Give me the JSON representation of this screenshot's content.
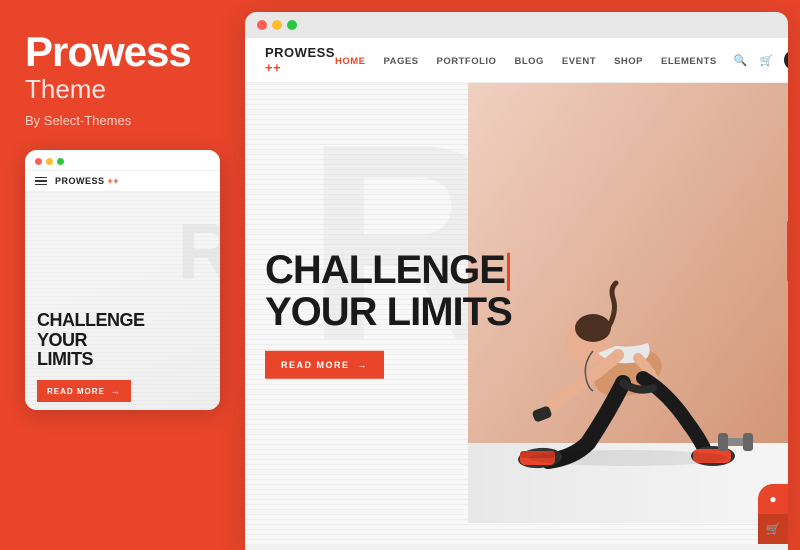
{
  "leftPanel": {
    "title": "Prowess",
    "subtitle": "Theme",
    "by": "By Select-Themes"
  },
  "mobileMockup": {
    "dots": [
      "red",
      "yellow",
      "green"
    ],
    "logo": "PROWESS",
    "logoSuffix": "++",
    "heroText": {
      "line1": "CHALLENGE",
      "line2": "YOUR",
      "line3": "LIMITS"
    },
    "readMoreLabel": "READ MORE"
  },
  "browserMockup": {
    "dots": [
      "red",
      "yellow",
      "green"
    ],
    "navbar": {
      "logo": "PROWESS",
      "logoSuffix": "++",
      "links": [
        {
          "label": "HOME",
          "active": true
        },
        {
          "label": "PAGES",
          "active": false
        },
        {
          "label": "PORTFOLIO",
          "active": false
        },
        {
          "label": "BLOG",
          "active": false
        },
        {
          "label": "EVENT",
          "active": false
        },
        {
          "label": "SHOP",
          "active": false
        },
        {
          "label": "ELEMENTS",
          "active": false
        }
      ]
    },
    "hero": {
      "line1": "CHALLENGE",
      "line2": "YOUR LIMITS",
      "readMoreLabel": "READ MORE"
    }
  },
  "colors": {
    "accent": "#e8452a",
    "dark": "#1a1a1a",
    "white": "#ffffff",
    "light": "#f8f8f8"
  },
  "icons": {
    "arrow": "→",
    "search": "🔍",
    "cart": "🛒",
    "menu": "☰",
    "hamburger": "≡"
  }
}
